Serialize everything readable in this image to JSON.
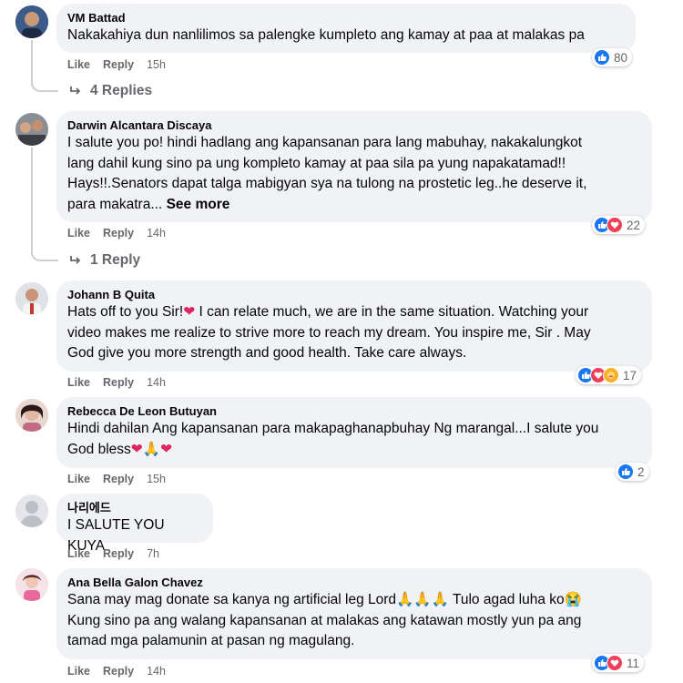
{
  "actions": {
    "like": "Like",
    "reply": "Reply"
  },
  "comments": [
    {
      "author": "VM Battad",
      "lines": [
        "Nakakahiya dun nanlilimos sa palengke kumpleto ang kamay at paa at malakas pa"
      ],
      "time": "15h",
      "reaction_count": "80",
      "reactions": [
        "like"
      ],
      "replies": "4 Replies"
    },
    {
      "author": "Darwin Alcantara Discaya",
      "lines": [
        "I salute you po! hindi hadlang ang kapansanan para lang mabuhay, nakakalungkot",
        "lang dahil kung sino pa ung kompleto kamay at paa sila pa yung napakatamad!!",
        "Hays!!.Senators dapat talga mabigyan sya na tulong na prostetic leg..he deserve it,",
        "para makatra..."
      ],
      "see_more": "See more",
      "time": "14h",
      "reaction_count": "22",
      "reactions": [
        "like",
        "love"
      ],
      "replies": "1 Reply"
    },
    {
      "author": "Johann B Quita",
      "line1_a": "Hats off to you Sir!",
      "line1_b": " I can relate much, we are in the same situation. Watching your",
      "lines": [
        "video makes me realize to strive more to reach my dream. You inspire me, Sir . May",
        "God give you more strength and good health. Take care always."
      ],
      "time": "14h",
      "reaction_count": "17",
      "reactions": [
        "like",
        "love",
        "care"
      ]
    },
    {
      "author": "Rebecca De Leon Butuyan",
      "lines": [
        "Hindi dahilan Ang kapansanan para makapaghanapbuhay Ng marangal...I salute you"
      ],
      "line2": "God bless",
      "time": "15h",
      "reaction_count": "2",
      "reactions": [
        "like"
      ]
    },
    {
      "author": "나리에드",
      "lines": [
        "I SALUTE YOU KUYA"
      ],
      "time": "7h"
    },
    {
      "author": "Ana Bella Galon Chavez",
      "line1_a": "Sana may mag donate sa kanya ng artificial leg Lord",
      "line1_b": " Tulo agad luha ko",
      "lines": [
        "Kung sino pa ang walang kapansanan at malakas ang katawan mostly yun pa ang",
        "tamad mga palamunin at pasan ng magulang."
      ],
      "time": "14h",
      "reaction_count": "11",
      "reactions": [
        "like",
        "love"
      ]
    }
  ],
  "colors": {
    "bubble": "#f0f2f5",
    "like": "#1877f2",
    "love": "#f33e58",
    "meta": "#65676b"
  }
}
